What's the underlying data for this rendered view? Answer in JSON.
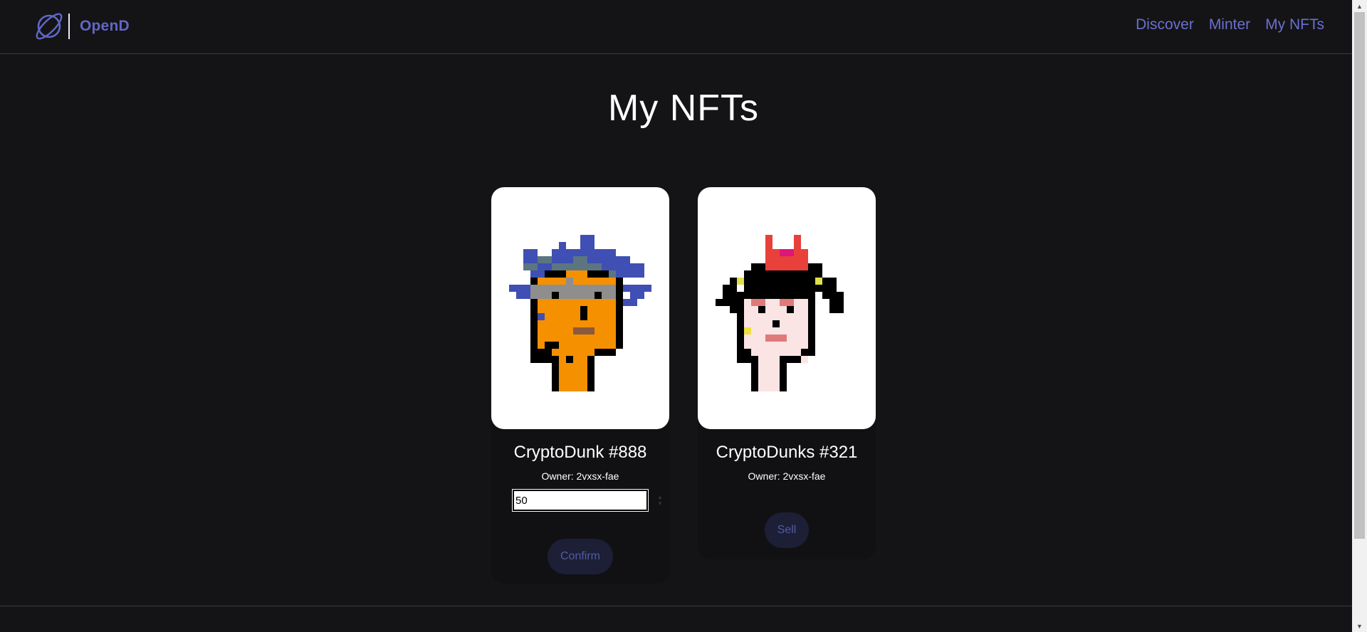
{
  "header": {
    "brand": "OpenD",
    "nav": [
      {
        "label": "Discover"
      },
      {
        "label": "Minter"
      },
      {
        "label": "My NFTs"
      }
    ]
  },
  "page": {
    "title": "My NFTs"
  },
  "cards": [
    {
      "name": "CryptoDunk #888",
      "owner": "Owner: 2vxsx-fae",
      "price_value": "50",
      "button_label": "Confirm"
    },
    {
      "name": "CryptoDunks #321",
      "owner": "Owner: 2vxsx-fae",
      "button_label": "Sell"
    }
  ],
  "colors": {
    "background": "#141416",
    "accent": "#6166c5",
    "button_bg": "#1c1f36",
    "button_text": "#545aa3"
  },
  "icons": {
    "logo": "planet-logo-icon",
    "spinner_up": "chevron-up-icon",
    "spinner_down": "chevron-down-icon",
    "scroll_up": "scroll-up-arrow-icon",
    "scroll_down": "scroll-down-arrow-icon"
  }
}
